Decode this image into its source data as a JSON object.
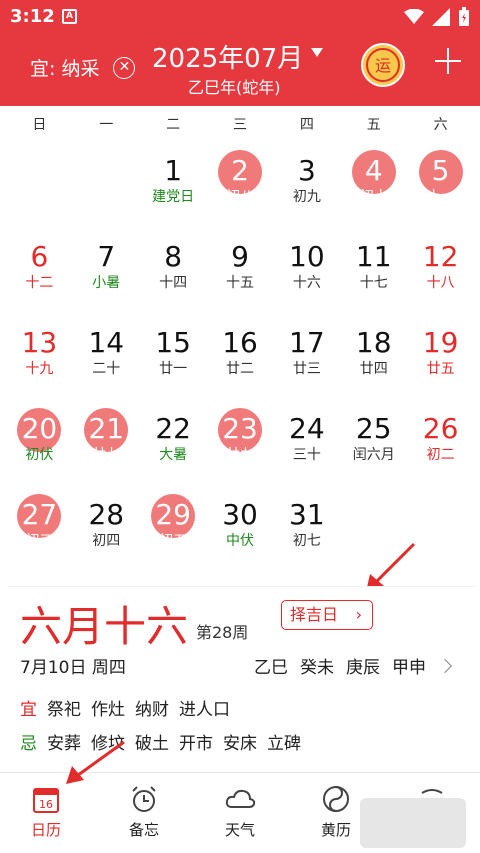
{
  "status": {
    "time": "3:12",
    "notif_glyph": "A"
  },
  "header": {
    "yi_label": "宜: 纳采",
    "title": "2025年07月",
    "subtitle": "乙巳年(蛇年)",
    "yun_glyph": "运"
  },
  "weekdays": [
    "日",
    "一",
    "二",
    "三",
    "四",
    "五",
    "六"
  ],
  "days": [
    {
      "d": "",
      "l": ""
    },
    {
      "d": "",
      "l": ""
    },
    {
      "d": "1",
      "l": "建党日",
      "fest": true
    },
    {
      "d": "2",
      "l": "初八",
      "sel": true
    },
    {
      "d": "3",
      "l": "初九"
    },
    {
      "d": "4",
      "l": "初十",
      "sel": true
    },
    {
      "d": "5",
      "l": "十一",
      "sel": true,
      "we": true
    },
    {
      "d": "6",
      "l": "十二",
      "we": true
    },
    {
      "d": "7",
      "l": "小暑",
      "fest": true
    },
    {
      "d": "8",
      "l": "十四"
    },
    {
      "d": "9",
      "l": "十五"
    },
    {
      "d": "10",
      "l": "十六"
    },
    {
      "d": "11",
      "l": "十七"
    },
    {
      "d": "12",
      "l": "十八",
      "we": true
    },
    {
      "d": "13",
      "l": "十九",
      "we": true
    },
    {
      "d": "14",
      "l": "二十"
    },
    {
      "d": "15",
      "l": "廿一"
    },
    {
      "d": "16",
      "l": "廿二"
    },
    {
      "d": "17",
      "l": "廿三"
    },
    {
      "d": "18",
      "l": "廿四"
    },
    {
      "d": "19",
      "l": "廿五",
      "we": true
    },
    {
      "d": "20",
      "l": "初伏",
      "sel": true,
      "we": true,
      "fest": true
    },
    {
      "d": "21",
      "l": "廿七",
      "sel": true
    },
    {
      "d": "22",
      "l": "大暑",
      "fest": true
    },
    {
      "d": "23",
      "l": "廿九",
      "sel": true
    },
    {
      "d": "24",
      "l": "三十"
    },
    {
      "d": "25",
      "l": "闰六月"
    },
    {
      "d": "26",
      "l": "初二",
      "we": true
    },
    {
      "d": "27",
      "l": "初三",
      "sel": true,
      "we": true
    },
    {
      "d": "28",
      "l": "初四"
    },
    {
      "d": "29",
      "l": "初五",
      "sel": true
    },
    {
      "d": "30",
      "l": "中伏",
      "fest": true
    },
    {
      "d": "31",
      "l": "初七"
    }
  ],
  "detail": {
    "lunar_date": "六月十六",
    "week_no": "第28周",
    "zeji_label": "择吉日",
    "solar": "7月10日  周四",
    "ganzhi": [
      "乙巳",
      "癸未",
      "庚辰",
      "甲申"
    ],
    "yi_label": "宜",
    "yi_items": [
      "祭祀",
      "作灶",
      "纳财",
      "进人口"
    ],
    "ji_label": "忌",
    "ji_items": [
      "安葬",
      "修坟",
      "破土",
      "开市",
      "安床",
      "立碑"
    ]
  },
  "nav": [
    {
      "label": "日历",
      "icon": "calendar-icon",
      "badge": "16",
      "active": true
    },
    {
      "label": "备忘",
      "icon": "alarm-clock-icon"
    },
    {
      "label": "天气",
      "icon": "cloud-icon"
    },
    {
      "label": "黄历",
      "icon": "yin-yang-icon"
    },
    {
      "label": "",
      "icon": "more-icon"
    }
  ],
  "colors": {
    "accent": "#e5393f",
    "selected_circle": "#f07a7a",
    "festival": "#1f8a1f",
    "weekend": "#e22b2b"
  }
}
